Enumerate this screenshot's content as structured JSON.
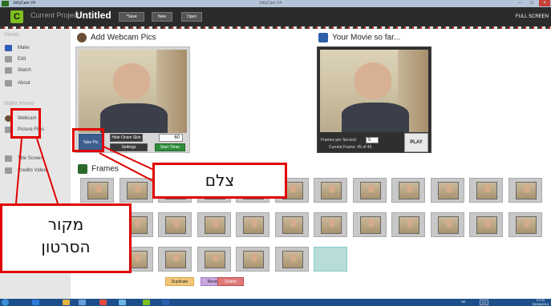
{
  "window": {
    "title": "JellyCam V4",
    "center_title": "JellyCam V4",
    "minimize": "−",
    "maximize": "□",
    "close": "×"
  },
  "topbar": {
    "logo": "C",
    "project_label": "Current Project:",
    "project_name": "Untitled",
    "save": "*Save",
    "new": "New",
    "open": "Open",
    "fullscreen": "FULL SCREEN"
  },
  "sidebar": {
    "views_heading": "Views",
    "views": [
      {
        "label": "Make",
        "icon": "make-icon"
      },
      {
        "label": "Edit",
        "icon": "edit-icon"
      },
      {
        "label": "Watch",
        "icon": "watch-icon"
      },
      {
        "label": "About",
        "icon": "about-icon"
      }
    ],
    "make_movie_heading": "Make Movie",
    "sources": [
      {
        "label": "Webcam",
        "icon": "webcam-icon"
      },
      {
        "label": "Picture Files",
        "icon": "picture-files-icon"
      },
      {
        "label": "Title Screen",
        "icon": "title-screen-icon"
      },
      {
        "label": "Credits Video",
        "icon": "credits-video-icon"
      }
    ]
  },
  "webcam": {
    "title": "Add Webcam Pics",
    "take_pic": "Take Pic",
    "hide_onion": "Hide Onion Skin",
    "onion_value": "60",
    "settings": "Settings",
    "start_timer": "Start Timer"
  },
  "movie": {
    "title": "Your Movie so far...",
    "fps_label": "Frames per Second",
    "fps_value": "5",
    "current_frame": "Current Frame: 45 of 45",
    "play": "PLAY"
  },
  "frames": {
    "title": "Frames",
    "thumbnail_count": 31,
    "highlighted": 1
  },
  "actions": {
    "duplicate": "Duplicate",
    "reverse": "Reverse",
    "delete": "Delete"
  },
  "taskbar": {
    "time": "07:00",
    "date": "05/06/2014",
    "lang": "HE",
    "battery": "100"
  },
  "annotations": {
    "take_pic_callout": "צלם",
    "source_callout_line1": "מקור",
    "source_callout_line2": "הסרטון"
  },
  "colors": {
    "annotation": "#e00000",
    "accent": "#7fbf1f",
    "dark": "#2b2b2b"
  }
}
